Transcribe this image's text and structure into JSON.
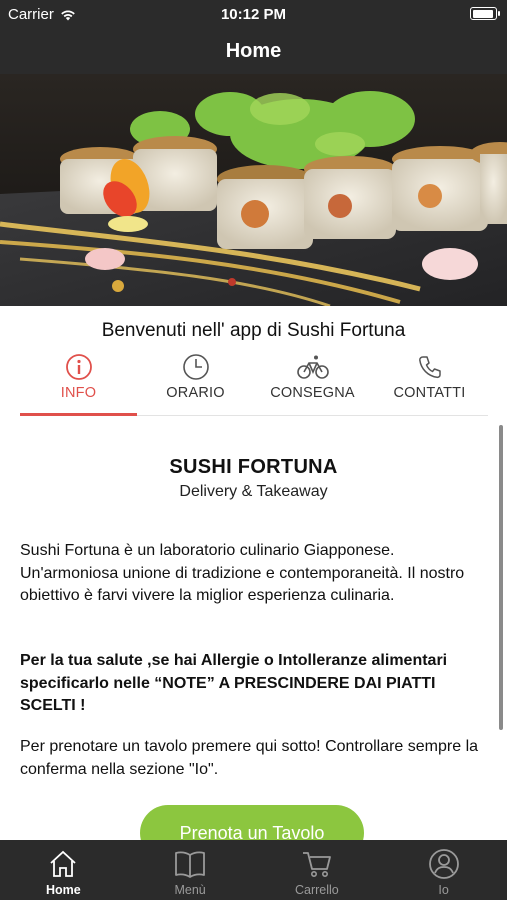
{
  "status_bar": {
    "carrier": "Carrier",
    "time": "10:12 PM"
  },
  "nav": {
    "title": "Home"
  },
  "welcome": "Benvenuti nell' app di Sushi Fortuna",
  "tabs": [
    {
      "label": "INFO",
      "icon": "info-icon",
      "active": true
    },
    {
      "label": "ORARIO",
      "icon": "clock-icon",
      "active": false
    },
    {
      "label": "CONSEGNA",
      "icon": "bicycle-icon",
      "active": false
    },
    {
      "label": "CONTATTI",
      "icon": "phone-icon",
      "active": false
    }
  ],
  "info": {
    "title": "SUSHI FORTUNA",
    "subtitle": "Delivery & Takeaway",
    "paragraph1": "Sushi Fortuna è un laboratorio culinario Giapponese. Un'armoniosa unione di tradizione e contemporaneità. Il nostro obiettivo è farvi vivere la miglior esperienza culinaria.",
    "paragraph2": "Per la tua salute ,se hai Allergie o Intolleranze alimentari specificarlo nelle “NOTE” A PRESCINDERE DAI PIATTI SCELTI !",
    "paragraph3": "Per prenotare un tavolo premere qui sotto! Controllare sempre la conferma nella sezione \"Io\".",
    "book_button": "Prenota un Tavolo"
  },
  "tab_bar": [
    {
      "label": "Home",
      "icon": "home-icon",
      "active": true
    },
    {
      "label": "Menù",
      "icon": "book-icon",
      "active": false
    },
    {
      "label": "Carrello",
      "icon": "cart-icon",
      "active": false
    },
    {
      "label": "Io",
      "icon": "user-icon",
      "active": false
    }
  ],
  "colors": {
    "accent": "#e0504b",
    "button": "#8cc63f",
    "bars": "#2b2b2b"
  }
}
